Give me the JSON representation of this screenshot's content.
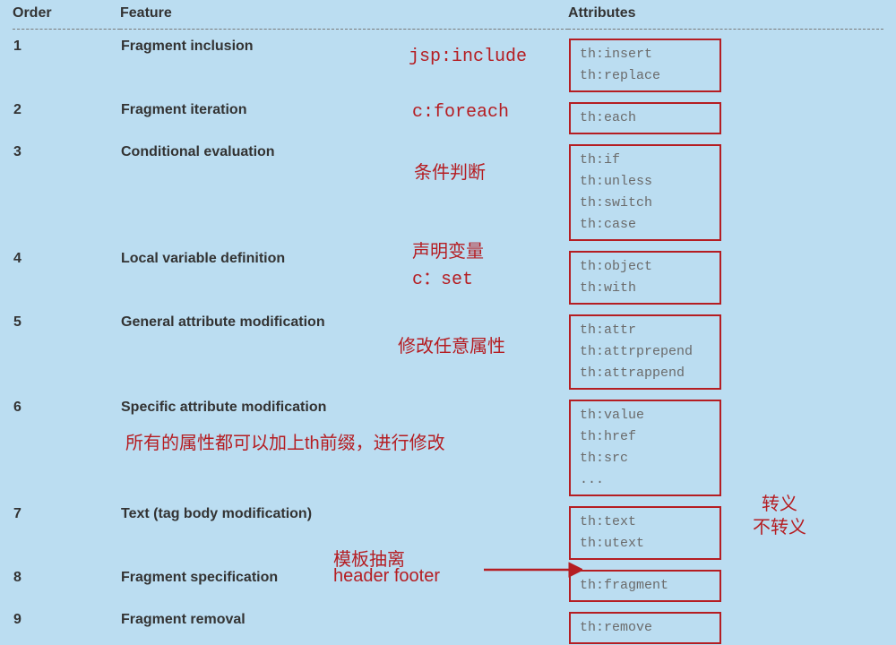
{
  "headers": {
    "order": "Order",
    "feature": "Feature",
    "attrs": "Attributes"
  },
  "rows": [
    {
      "order": "1",
      "feature": "Fragment inclusion",
      "attrs": [
        "th:insert",
        "th:replace"
      ]
    },
    {
      "order": "2",
      "feature": "Fragment iteration",
      "attrs": [
        "th:each"
      ]
    },
    {
      "order": "3",
      "feature": "Conditional evaluation",
      "attrs": [
        "th:if",
        "th:unless",
        "th:switch",
        "th:case"
      ]
    },
    {
      "order": "4",
      "feature": "Local variable definition",
      "attrs": [
        "th:object",
        "th:with"
      ]
    },
    {
      "order": "5",
      "feature": "General attribute modification",
      "attrs": [
        "th:attr",
        "th:attrprepend",
        "th:attrappend"
      ]
    },
    {
      "order": "6",
      "feature": "Specific attribute modification",
      "attrs": [
        "th:value",
        "th:href",
        "th:src",
        "..."
      ]
    },
    {
      "order": "7",
      "feature": "Text (tag body modification)",
      "attrs": [
        "th:text",
        "th:utext"
      ]
    },
    {
      "order": "8",
      "feature": "Fragment specification",
      "attrs": [
        "th:fragment"
      ]
    },
    {
      "order": "9",
      "feature": "Fragment removal",
      "attrs": [
        "th:remove"
      ]
    }
  ],
  "annotations": {
    "jsp_include": "jsp:include",
    "c_foreach": "c:foreach",
    "cond": "条件判断",
    "var1": "声明变量",
    "var2": "c：set",
    "attrmod": "修改任意属性",
    "specific": "所有的属性都可以加上th前缀，进行修改",
    "escape": "转义",
    "noescape": "不转义",
    "tpl1": "模板抽离",
    "tpl2": "header  footer"
  }
}
